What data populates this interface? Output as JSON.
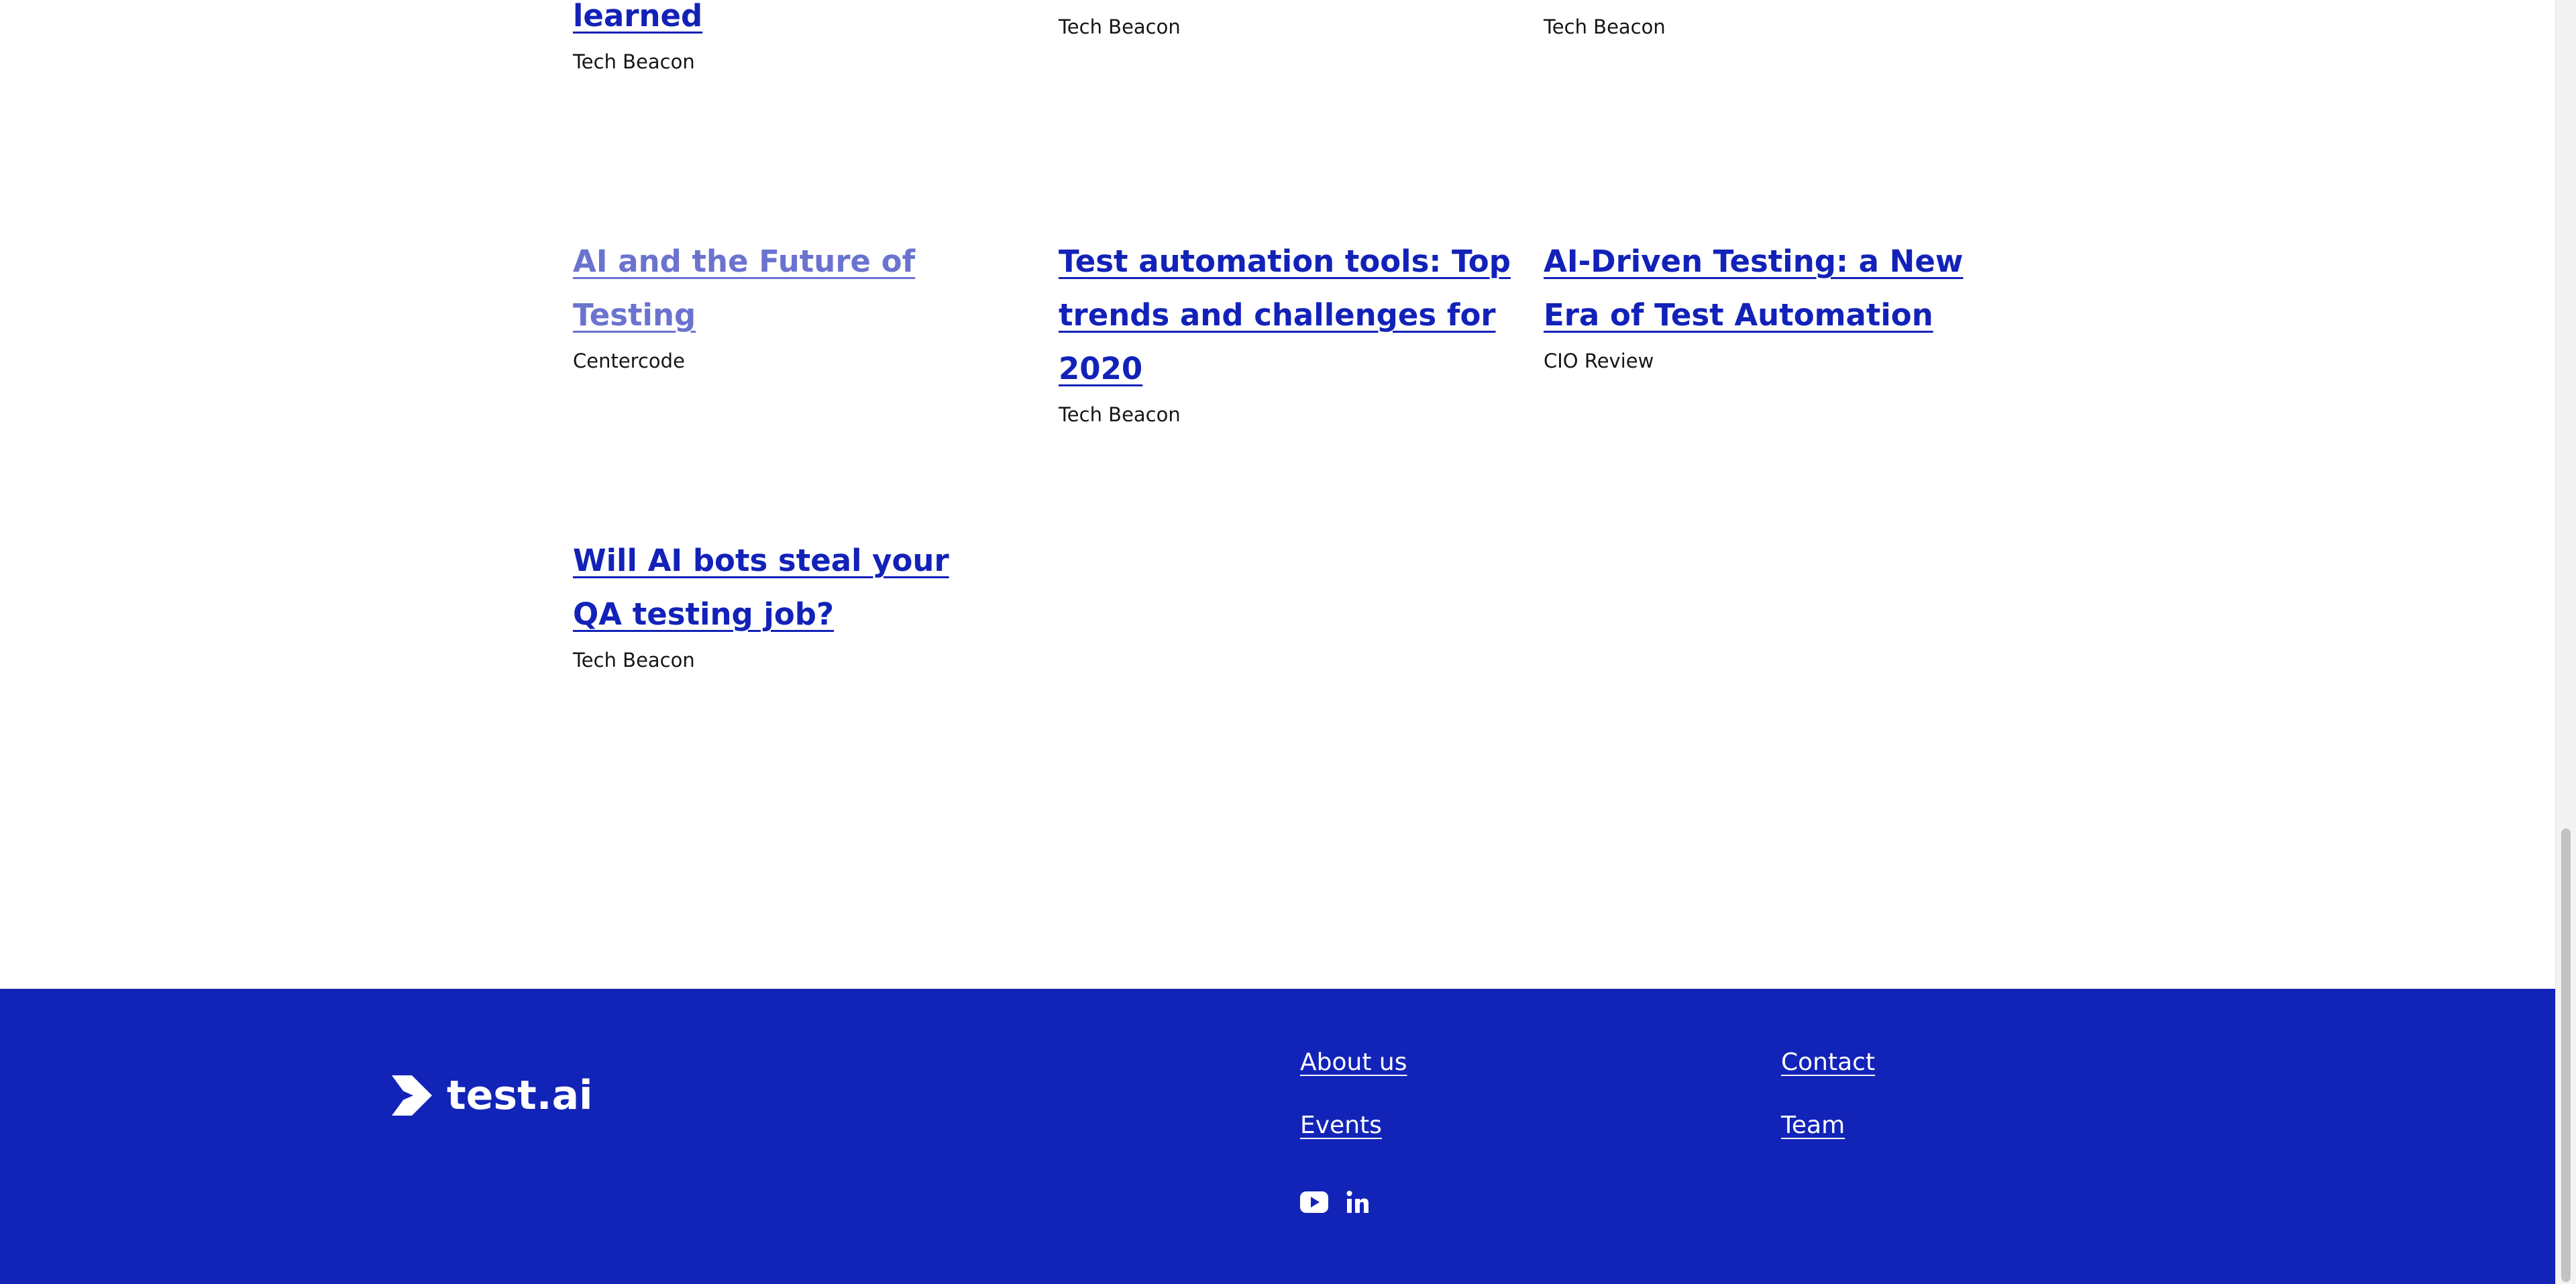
{
  "articles": [
    {
      "title": "learned",
      "source": "Tech Beacon"
    },
    {
      "title": "",
      "source": "Tech Beacon"
    },
    {
      "title": "",
      "source": "Tech Beacon"
    },
    {
      "title": "AI and the Future of Testing",
      "source": "Centercode"
    },
    {
      "title": "Test automation tools: Top trends and challenges for 2020",
      "source": "Tech Beacon"
    },
    {
      "title": "AI-Driven Testing: a New Era of Test Automation",
      "source": "CIO Review"
    },
    {
      "title": "Will AI bots steal your QA testing job?",
      "source": "Tech Beacon"
    }
  ],
  "footer": {
    "logo_text": "test.ai",
    "links": {
      "about": "About us",
      "events": "Events",
      "contact": "Contact",
      "team": "Team"
    },
    "social": [
      "youtube-icon",
      "linkedin-icon"
    ],
    "background": "#1224b8"
  },
  "colors": {
    "link": "#1222b8",
    "visited_link": "#6b73cf",
    "text": "#161616"
  }
}
